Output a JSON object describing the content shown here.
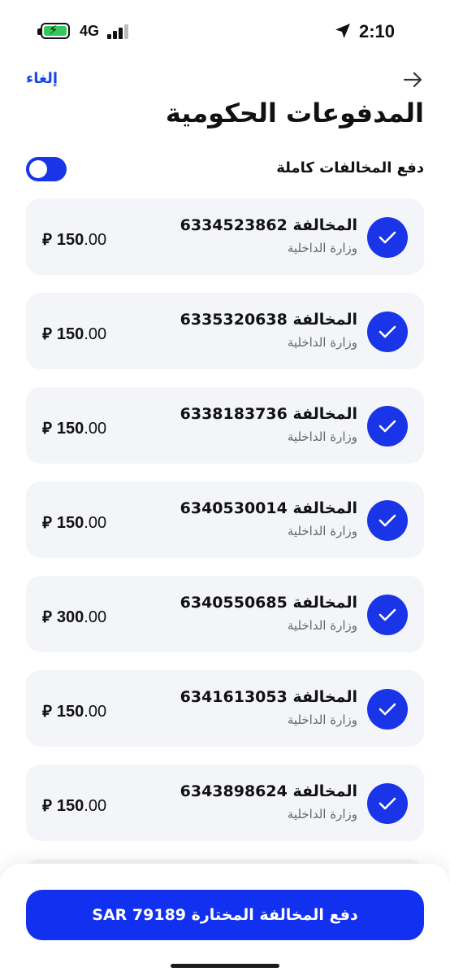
{
  "status_bar": {
    "time": "2:10",
    "network": "4G",
    "icons": [
      "battery-charging-icon",
      "signal-icon",
      "location-arrow-icon"
    ]
  },
  "header": {
    "cancel_label": "إلغاء",
    "back_icon": "arrow-right-icon",
    "title": "المدفوعات الحكومية"
  },
  "toggle": {
    "label": "دفع المخالفات كاملة",
    "on": true
  },
  "violations": [
    {
      "title": "المخالفة 6334523862",
      "issuer": "وزارة الداخلية",
      "amount_int": "150",
      "amount_dec": ".00",
      "currency": "⃁",
      "selected": true
    },
    {
      "title": "المخالفة 6335320638",
      "issuer": "وزارة الداخلية",
      "amount_int": "150",
      "amount_dec": ".00",
      "currency": "⃁",
      "selected": true
    },
    {
      "title": "المخالفة 6338183736",
      "issuer": "وزارة الداخلية",
      "amount_int": "150",
      "amount_dec": ".00",
      "currency": "⃁",
      "selected": true
    },
    {
      "title": "المخالفة 6340530014",
      "issuer": "وزارة الداخلية",
      "amount_int": "150",
      "amount_dec": ".00",
      "currency": "⃁",
      "selected": true
    },
    {
      "title": "المخالفة 6340550685",
      "issuer": "وزارة الداخلية",
      "amount_int": "300",
      "amount_dec": ".00",
      "currency": "⃁",
      "selected": true
    },
    {
      "title": "المخالفة 6341613053",
      "issuer": "وزارة الداخلية",
      "amount_int": "150",
      "amount_dec": ".00",
      "currency": "⃁",
      "selected": true
    },
    {
      "title": "المخالفة 6343898624",
      "issuer": "وزارة الداخلية",
      "amount_int": "150",
      "amount_dec": ".00",
      "currency": "⃁",
      "selected": true
    }
  ],
  "pay_button": {
    "label": "دفع المخالفة المختارة SAR 79189"
  },
  "colors": {
    "accent": "#1a34e8",
    "card_bg": "#f4f5f8",
    "link": "#1a47e8"
  }
}
